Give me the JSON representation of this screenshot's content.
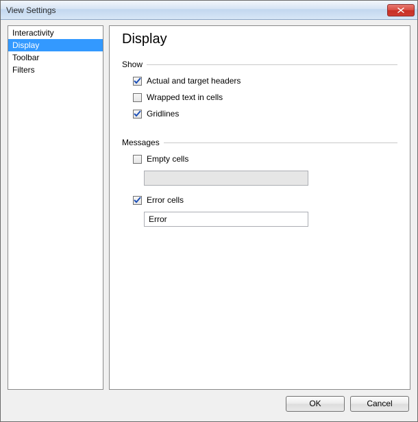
{
  "window": {
    "title": "View Settings"
  },
  "sidebar": {
    "items": [
      {
        "label": "Interactivity",
        "selected": false
      },
      {
        "label": "Display",
        "selected": true
      },
      {
        "label": "Toolbar",
        "selected": false
      },
      {
        "label": "Filters",
        "selected": false
      }
    ]
  },
  "page": {
    "title": "Display",
    "groups": {
      "show": {
        "label": "Show",
        "options": {
          "actual_target_headers": {
            "label": "Actual and target headers",
            "checked": true
          },
          "wrapped_text": {
            "label": "Wrapped text in cells",
            "checked": false
          },
          "gridlines": {
            "label": "Gridlines",
            "checked": true
          }
        }
      },
      "messages": {
        "label": "Messages",
        "options": {
          "empty_cells": {
            "label": "Empty cells",
            "checked": false,
            "value": ""
          },
          "error_cells": {
            "label": "Error cells",
            "checked": true,
            "value": "Error"
          }
        }
      }
    }
  },
  "footer": {
    "ok": "OK",
    "cancel": "Cancel"
  }
}
